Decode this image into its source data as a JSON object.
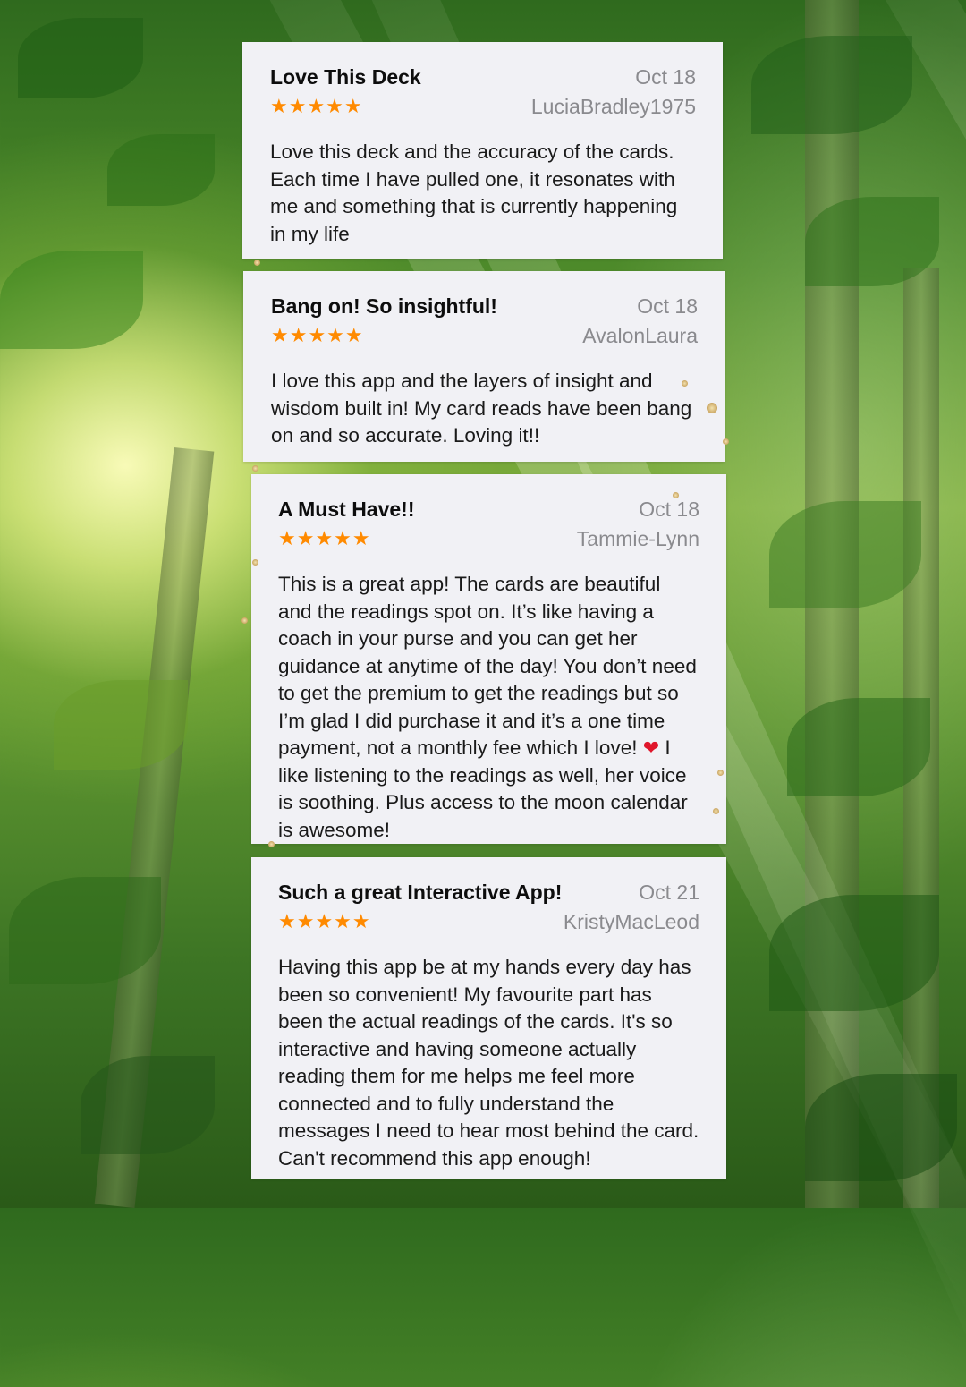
{
  "colors": {
    "star": "#ff8a00",
    "card_bg": "#f1f1f5",
    "meta_text": "#8a8a8e",
    "heart": "#e0162b"
  },
  "reviews": [
    {
      "title": "Love This Deck",
      "date": "Oct 18",
      "author": "LuciaBradley1975",
      "stars": "★★★★★",
      "rating": 5,
      "body": "Love this deck and the accuracy of the cards. Each time I have pulled one, it resonates with me and something that is currently happening in my life"
    },
    {
      "title": "Bang on! So insightful!",
      "date": "Oct 18",
      "author": "AvalonLaura",
      "stars": "★★★★★",
      "rating": 5,
      "body": "I love this app and the layers of insight and wisdom built in! My card reads have been bang on and so accurate. Loving it!!"
    },
    {
      "title": "A Must Have!!",
      "date": "Oct 18",
      "author": "Tammie-Lynn",
      "stars": "★★★★★",
      "rating": 5,
      "body_part1": "This is a great app! The cards are beautiful and the readings spot on. It’s like having a coach in your purse and you can get her guidance at anytime of the day! You don’t need to get the premium to get the readings but so I’m glad I did purchase it and it’s a one time payment, not a monthly fee which I love!",
      "heart": "❤",
      "body_part2": " I like listening to the readings as well, her voice is soothing. Plus access to the moon calendar is awesome!"
    },
    {
      "title": "Such a great Interactive App!",
      "date": "Oct 21",
      "author": "KristyMacLeod",
      "stars": "★★★★★",
      "rating": 5,
      "body": "Having this app be at my hands every day has been so convenient! My favourite part has been the actual readings of the cards. It's so interactive and having someone actually reading them for me helps me feel more connected and to fully understand the messages I need to hear most behind the card. Can't recommend this app enough!"
    }
  ]
}
